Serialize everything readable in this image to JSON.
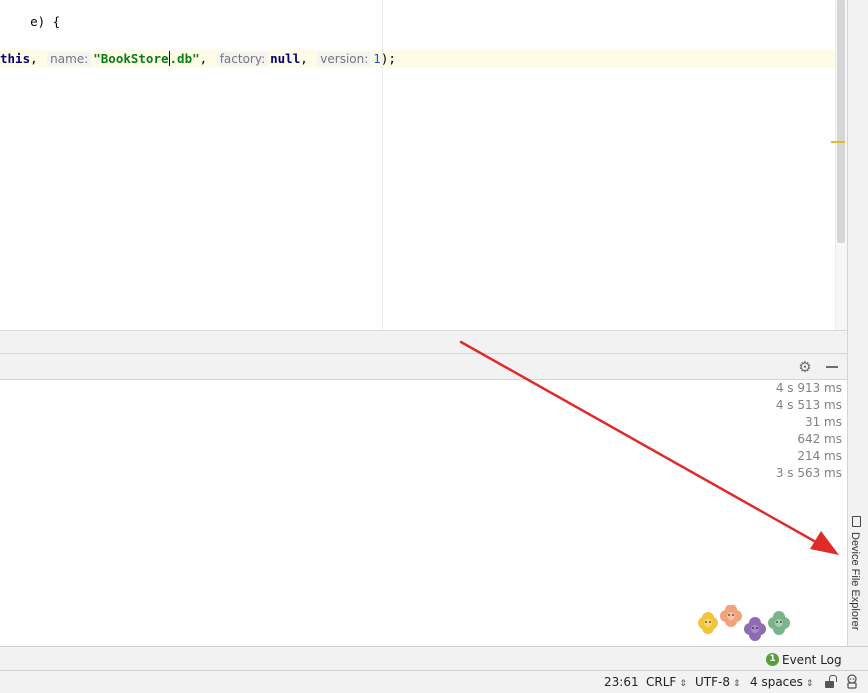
{
  "editor": {
    "line1": {
      "text": "e) {"
    },
    "line2": {
      "kw_this": "this",
      "comma1": ",",
      "hint_name": "name:",
      "str_open": "\"BookStore",
      "str_close": ".db\"",
      "comma2": ",",
      "hint_factory": "factory:",
      "kw_null": "null",
      "comma3": ",",
      "hint_version": "version:",
      "num_version": "1",
      "end": ");"
    },
    "colors": {
      "keyword": "#000080",
      "string": "#067d17",
      "number": "#1750eb",
      "current_line": "#fefce6"
    }
  },
  "build_panel": {
    "timings": [
      "4 s 913 ms",
      "4 s 513 ms",
      "31 ms",
      "642 ms",
      "214 ms",
      "3 s 563 ms"
    ],
    "icons": {
      "settings": "gear-icon",
      "hide": "minimize-icon"
    }
  },
  "right_tool_window": {
    "label": "Device File Explorer",
    "icon": "device-icon"
  },
  "event_log": {
    "badge": "1",
    "label": "Event Log"
  },
  "status_bar": {
    "position": "23:61",
    "line_separator": "CRLF",
    "encoding": "UTF-8",
    "indent": "4 spaces",
    "caret_symbol": "⇕",
    "icons": [
      "lock-icon",
      "inspector-icon"
    ]
  },
  "annotation": {
    "arrow_color": "#e02b2b"
  }
}
